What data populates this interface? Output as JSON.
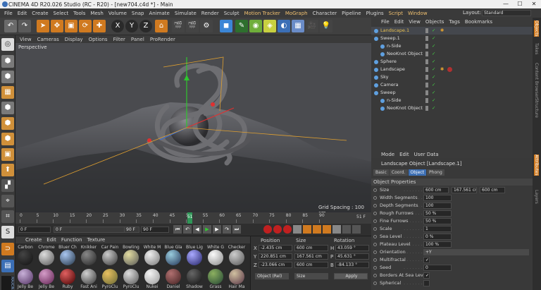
{
  "window": {
    "title": "CINEMA 4D R20.026 Studio (RC - R20) - [new704.c4d *] - Main",
    "min": "—",
    "max": "☐",
    "close": "✕"
  },
  "menu": [
    "File",
    "Edit",
    "Create",
    "Select",
    "Tools",
    "Mesh",
    "Volume",
    "Snap",
    "Animate",
    "Simulate",
    "Render",
    "Sculpt",
    "Motion Tracker",
    "MoGraph",
    "Character",
    "Pipeline",
    "Plugins",
    "Script",
    "Window"
  ],
  "layout": {
    "label": "Layout:",
    "value": "Standard"
  },
  "viewport": {
    "menu": [
      "View",
      "Cameras",
      "Display",
      "Options",
      "Filter",
      "Panel",
      "ProRender"
    ],
    "name": "Perspective",
    "grid": "Grid Spacing : 100 cm"
  },
  "timeline": {
    "ticks": [
      "0",
      "5",
      "10",
      "15",
      "20",
      "25",
      "30",
      "35",
      "40",
      "45",
      "50",
      "55",
      "60",
      "65",
      "70",
      "75",
      "80",
      "85",
      "90"
    ],
    "current": "51",
    "end": "51 F",
    "start_frame": "0 F",
    "min": "0 F",
    "max": "90 F",
    "max2": "90 F"
  },
  "materials": {
    "menu": [
      "Create",
      "Edit",
      "Function",
      "Texture"
    ],
    "items": [
      {
        "name": "Carbon",
        "top": "#444",
        "bot": "#111"
      },
      {
        "name": "Chrome",
        "top": "#ddd",
        "bot": "#555"
      },
      {
        "name": "Bluer Ch",
        "top": "#a9c6f0",
        "bot": "#234"
      },
      {
        "name": "Knikker",
        "top": "#888",
        "bot": "#222"
      },
      {
        "name": "Car Pain",
        "top": "#ccc",
        "bot": "#333"
      },
      {
        "name": "Bowling",
        "top": "#e2dca0",
        "bot": "#555"
      },
      {
        "name": "White M",
        "top": "#eee",
        "bot": "#777"
      },
      {
        "name": "Blue Gla",
        "top": "#9cd",
        "bot": "#235"
      },
      {
        "name": "Blue Lig",
        "top": "#aaf",
        "bot": "#226"
      },
      {
        "name": "White G",
        "top": "#fafafa",
        "bot": "#888"
      },
      {
        "name": "Checker",
        "top": "#ccc",
        "bot": "#555"
      },
      {
        "name": "Jelly Be",
        "top": "#c8b0d8",
        "bot": "#503060"
      },
      {
        "name": "Jelly Be",
        "top": "#d49cc8",
        "bot": "#602050"
      },
      {
        "name": "Ruby",
        "top": "#e06060",
        "bot": "#400"
      },
      {
        "name": "Fast Ani",
        "top": "#d0d0d0",
        "bot": "#333"
      },
      {
        "name": "PyroClu",
        "top": "#e8c060",
        "bot": "#663"
      },
      {
        "name": "PyroClu",
        "top": "#ddd",
        "bot": "#555"
      },
      {
        "name": "Nukei",
        "top": "#f4f4f4",
        "bot": "#999"
      },
      {
        "name": "Daniel",
        "top": "#b07070",
        "bot": "#402020"
      },
      {
        "name": "Shadow",
        "top": "#666",
        "bot": "#111"
      },
      {
        "name": "Grass",
        "top": "#8cb060",
        "bot": "#243"
      },
      {
        "name": "Hair Ma",
        "top": "#d0c0a0",
        "bot": "#534"
      }
    ]
  },
  "coords": {
    "heads": [
      "Position",
      "Size",
      "Rotation"
    ],
    "rows": [
      {
        "axis": "X",
        "pos": "-2.435 cm",
        "size": "600 cm",
        "rot_axis": "H",
        "rot": "43.059 °"
      },
      {
        "axis": "Y",
        "pos": "220.851 cm",
        "size": "167.561 cm",
        "rot_axis": "P",
        "rot": "45.631 °"
      },
      {
        "axis": "Z",
        "pos": "-23.066 cm",
        "size": "600 cm",
        "rot_axis": "B",
        "rot": "-84.133 °"
      }
    ],
    "mode": "Object (Rel)",
    "size_mode": "Size",
    "apply": "Apply"
  },
  "objmgr": {
    "menu": [
      "File",
      "Edit",
      "View",
      "Objects",
      "Tags",
      "Bookmarks"
    ],
    "rows": [
      {
        "name": "Landscape.1",
        "indent": 0,
        "sel": true,
        "color": "#e8c050"
      },
      {
        "name": "Sweep.1",
        "indent": 0,
        "sel": false,
        "color": "#ddd"
      },
      {
        "name": "n-Side",
        "indent": 1,
        "sel": false,
        "color": "#ddd"
      },
      {
        "name": "NeoKnot Object",
        "indent": 1,
        "sel": false,
        "color": "#ddd"
      },
      {
        "name": "Sphere",
        "indent": 0,
        "sel": false,
        "color": "#ddd"
      },
      {
        "name": "Landscape",
        "indent": 0,
        "sel": false,
        "color": "#ddd"
      },
      {
        "name": "Sky",
        "indent": 0,
        "sel": false,
        "color": "#ddd"
      },
      {
        "name": "Camera",
        "indent": 0,
        "sel": false,
        "color": "#ddd"
      },
      {
        "name": "Sweep",
        "indent": 0,
        "sel": false,
        "color": "#ddd"
      },
      {
        "name": "n-Side",
        "indent": 1,
        "sel": false,
        "color": "#ddd"
      },
      {
        "name": "NeoKnot Object",
        "indent": 1,
        "sel": false,
        "color": "#ddd"
      }
    ]
  },
  "attr": {
    "menu": [
      "Mode",
      "Edit",
      "User Data"
    ],
    "title": "Landscape Object [Landscape.1]",
    "tabs": [
      "Basic",
      "Coord.",
      "Object",
      "Phong"
    ],
    "section": "Object Properties",
    "props": [
      {
        "label": "Size",
        "values": [
          "600 cm",
          "167.561 cm",
          "600 cm"
        ]
      },
      {
        "label": "Width Segments",
        "values": [
          "100"
        ]
      },
      {
        "label": "Depth Segments",
        "values": [
          "100"
        ]
      },
      {
        "label": "Rough Furrows",
        "values": [
          "50 %"
        ]
      },
      {
        "label": "Fine Furrows",
        "values": [
          "50 %"
        ]
      },
      {
        "label": "Scale",
        "values": [
          "1"
        ]
      },
      {
        "label": "Sea Level",
        "values": [
          "0 %"
        ]
      },
      {
        "label": "Plateau Level",
        "values": [
          "100 %"
        ]
      },
      {
        "label": "Orientation",
        "values": [
          "+Y"
        ]
      },
      {
        "label": "Multifractal",
        "values": [
          "✓"
        ]
      },
      {
        "label": "Seed",
        "values": [
          "0"
        ]
      },
      {
        "label": "Borders At Sea Level",
        "values": [
          "✓"
        ]
      },
      {
        "label": "Spherical",
        "values": [
          ""
        ]
      }
    ]
  },
  "side_tabs": [
    "Objects",
    "Takes",
    "Content Browser",
    "Structure",
    "Attributes",
    "Layers"
  ]
}
